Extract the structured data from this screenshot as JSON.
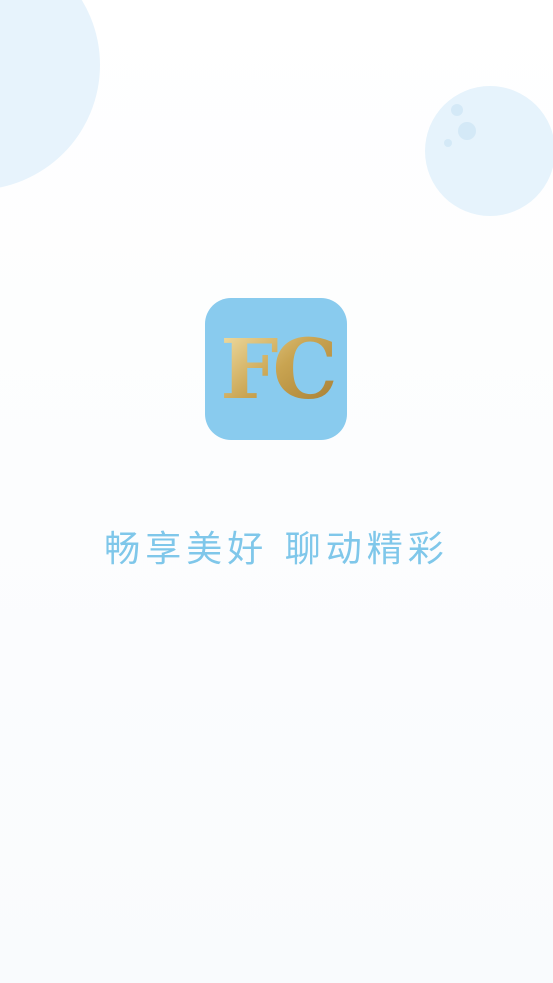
{
  "splash": {
    "logo": {
      "text": "FC",
      "icon": "fc-app-logo",
      "background_color": "#89cbee",
      "text_colors": [
        "#f5e4ad",
        "#c9a451",
        "#a37a30"
      ]
    },
    "tagline": "畅享美好 聊动精彩",
    "tagline_color": "#7fc7ea",
    "bubble_color": "#e3f1fb"
  }
}
